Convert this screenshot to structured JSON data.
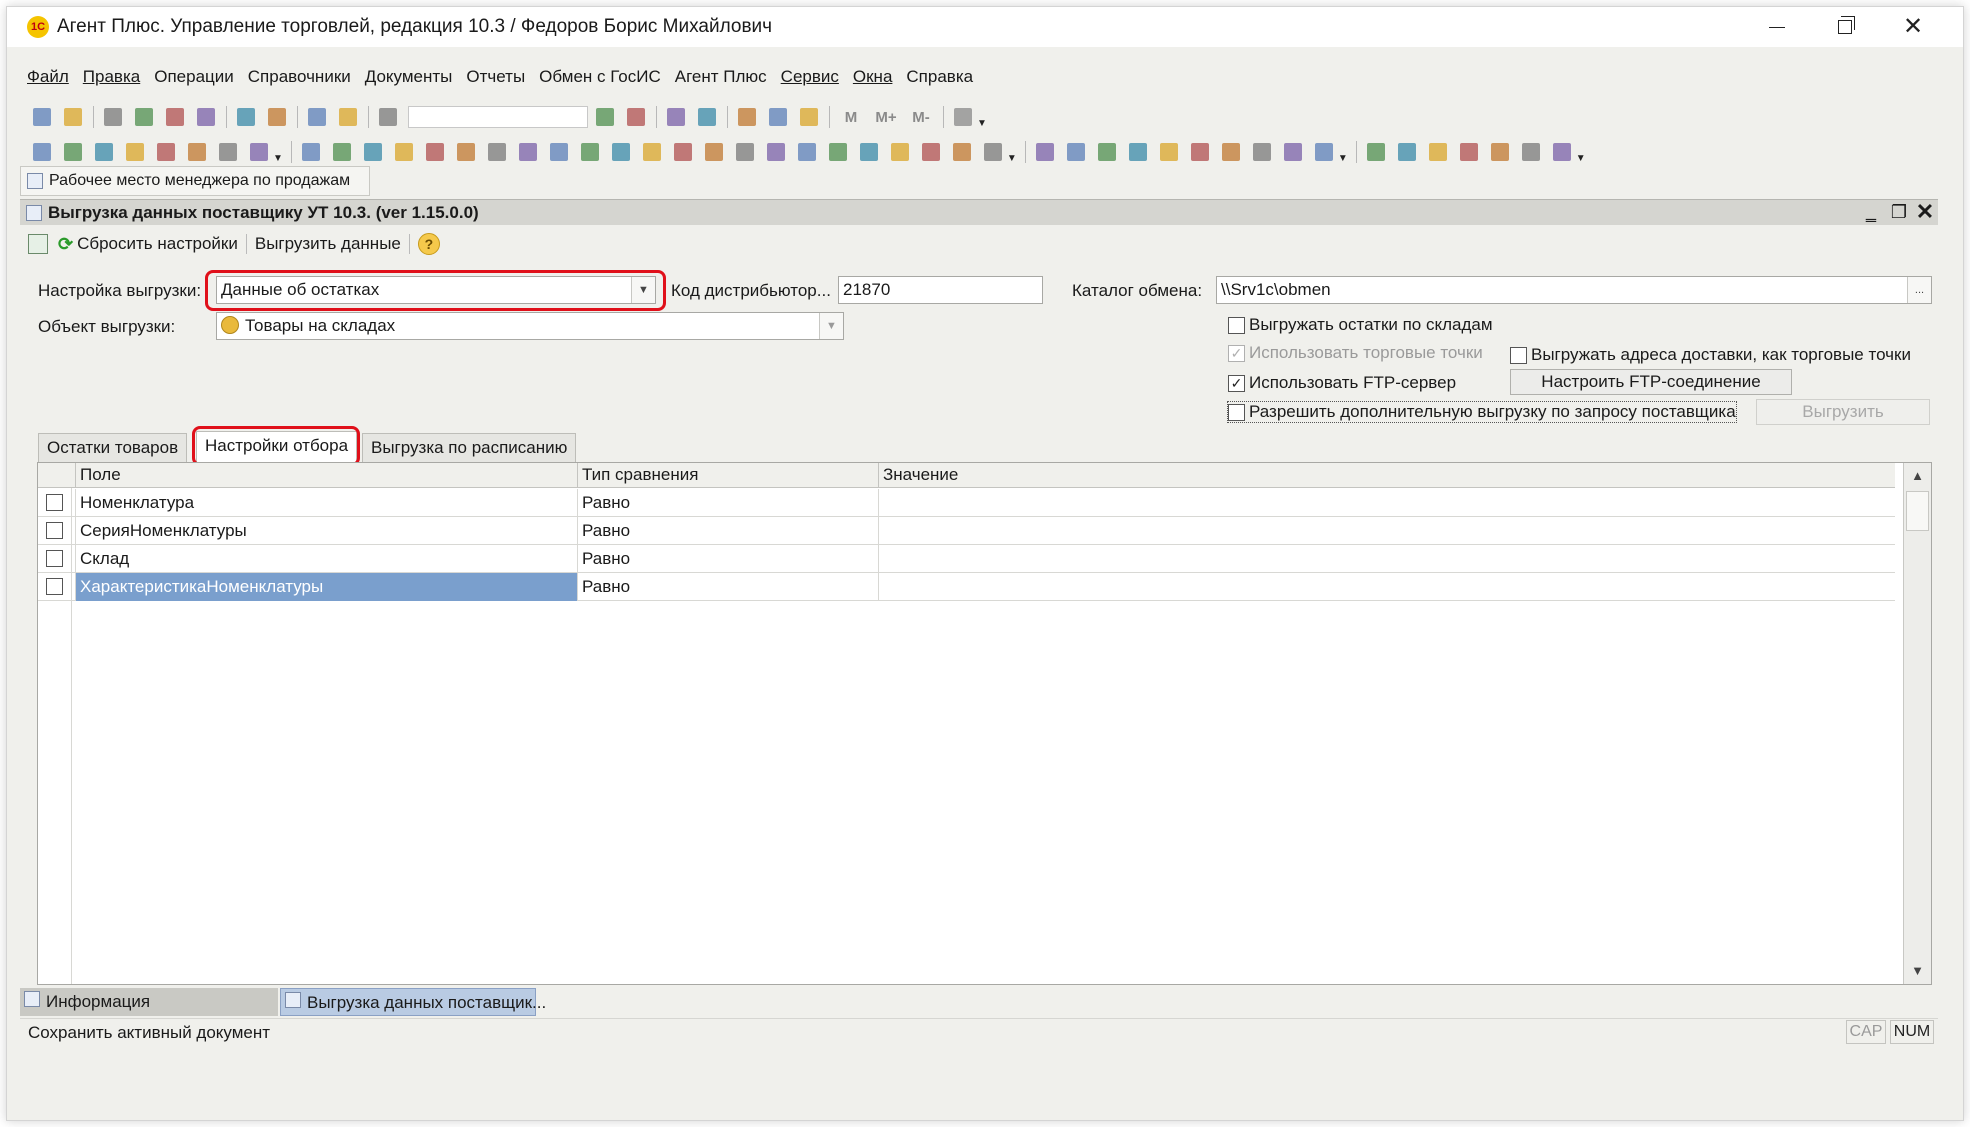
{
  "window": {
    "title": "Агент Плюс. Управление торговлей, редакция 10.3 / Федоров Борис Михайлович",
    "logo_text": "1С"
  },
  "menu": [
    {
      "label": "Файл",
      "underline": true
    },
    {
      "label": "Правка",
      "underline": true
    },
    {
      "label": "Операции",
      "underline": false
    },
    {
      "label": "Справочники",
      "underline": false
    },
    {
      "label": "Документы",
      "underline": false
    },
    {
      "label": "Отчеты",
      "underline": false
    },
    {
      "label": "Обмен с ГосИС",
      "underline": false
    },
    {
      "label": "Агент Плюс",
      "underline": false
    },
    {
      "label": "Сервис",
      "underline": true
    },
    {
      "label": "Окна",
      "underline": true
    },
    {
      "label": "Справка",
      "underline": false
    }
  ],
  "toolbar1_icons": [
    "new-document-icon",
    "open-icon",
    "save-icon",
    "cut-icon",
    "copy-icon",
    "paste-icon",
    "print-icon",
    "print-preview-icon",
    "undo-icon",
    "redo-icon",
    "find-icon"
  ],
  "toolbar1_icons_b": [
    "search-next-icon",
    "search-prev-icon",
    "windows-icon",
    "info-icon",
    "calculator-icon",
    "calendar-icon",
    "users-icon"
  ],
  "toolbar1_text_icons": [
    "M",
    "M+",
    "M-"
  ],
  "toolbar2_icon_count": 48,
  "workplace_tab": "Рабочее место менеджера по продажам",
  "document": {
    "title": "Выгрузка данных поставщику УТ 10.3. (ver 1.15.0.0)",
    "toolbar": {
      "reset_label": "Сбросить настройки",
      "export_label": "Выгрузить данные",
      "help_label": "?"
    },
    "form": {
      "setting_label": "Настройка выгрузки:",
      "setting_value": "Данные об остатках",
      "distributor_label": "Код дистрибьютор...",
      "distributor_value": "21870",
      "catalog_label": "Каталог обмена:",
      "catalog_value": "\\\\Srv1c\\obmen",
      "catalog_button": "...",
      "object_label": "Объект выгрузки:",
      "object_value": "Товары на складах"
    },
    "options": {
      "by_warehouses": {
        "label": "Выгружать остатки по складам",
        "checked": false,
        "enabled": true
      },
      "use_trade_points": {
        "label": "Использовать торговые точки",
        "checked": true,
        "enabled": false
      },
      "delivery_addresses": {
        "label": "Выгружать адреса доставки, как торговые точки",
        "checked": false,
        "enabled": true
      },
      "use_ftp": {
        "label": "Использовать FTP-сервер",
        "checked": true,
        "enabled": true
      },
      "allow_additional": {
        "label": "Разрешить дополнительную выгрузку по запросу поставщика",
        "checked": false,
        "enabled": true
      }
    },
    "buttons": {
      "ftp_setup": "Настроить FTP-соединение",
      "export": "Выгрузить"
    },
    "tabs": [
      {
        "label": "Остатки товаров",
        "active": false
      },
      {
        "label": "Настройки отбора",
        "active": true
      },
      {
        "label": "Выгрузка по расписанию",
        "active": false
      }
    ],
    "grid": {
      "columns": [
        "Поле",
        "Тип сравнения",
        "Значение"
      ],
      "rows": [
        {
          "field": "Номенклатура",
          "compare": "Равно",
          "value": "",
          "checked": false,
          "selected": false
        },
        {
          "field": "СерияНоменклатуры",
          "compare": "Равно",
          "value": "",
          "checked": false,
          "selected": false
        },
        {
          "field": "Склад",
          "compare": "Равно",
          "value": "",
          "checked": false,
          "selected": false
        },
        {
          "field": "ХарактеристикаНоменклатуры",
          "compare": "Равно",
          "value": "",
          "checked": false,
          "selected": true
        }
      ]
    }
  },
  "taskbar": {
    "info_tab": "Информация",
    "export_tab": "Выгрузка данных поставщик..."
  },
  "status": {
    "text": "Сохранить активный документ",
    "cap": "CAP",
    "num": "NUM"
  },
  "colors": {
    "highlight_red": "#e0101a",
    "selection_blue": "#7a9fcd"
  }
}
